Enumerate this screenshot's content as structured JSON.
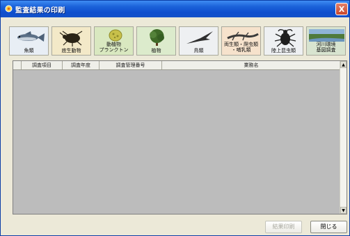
{
  "window": {
    "title": "監査結果の印刷",
    "close_glyph": "X",
    "icon": "app-icon"
  },
  "categories": [
    {
      "label": "魚類",
      "icon": "fish-icon",
      "bg": "#e8eef5"
    },
    {
      "label": "底生動物",
      "icon": "beetle-icon",
      "bg": "#f3e9c8"
    },
    {
      "label": "動植物\nプランクトン",
      "icon": "plankton-icon",
      "bg": "#d9e8c0"
    },
    {
      "label": "植物",
      "icon": "tree-icon",
      "bg": "#dcebcc"
    },
    {
      "label": "鳥類",
      "icon": "bird-icon",
      "bg": "#eef0f2"
    },
    {
      "label": "両生類・爬虫類\n・哺乳類",
      "icon": "lizard-icon",
      "bg": "#f6e2cc"
    },
    {
      "label": "陸上昆虫類",
      "icon": "stag-beetle-icon",
      "bg": "#eef0f2"
    },
    {
      "label": "河川環境\n基図調査",
      "icon": "river-landscape-icon",
      "bg": "#d8e4d0"
    }
  ],
  "table": {
    "columns": [
      "調査項目",
      "調査年度",
      "調査管理番号",
      "業務名"
    ],
    "rows": []
  },
  "scrollbar": {
    "up": "▲",
    "down": "▼"
  },
  "buttons": {
    "print": "結果印刷",
    "close": "閉じる"
  },
  "colors": {
    "titlebar": "#1b62d9",
    "window_bg": "#ece9d8",
    "grid_bg": "#bcbcbc"
  }
}
